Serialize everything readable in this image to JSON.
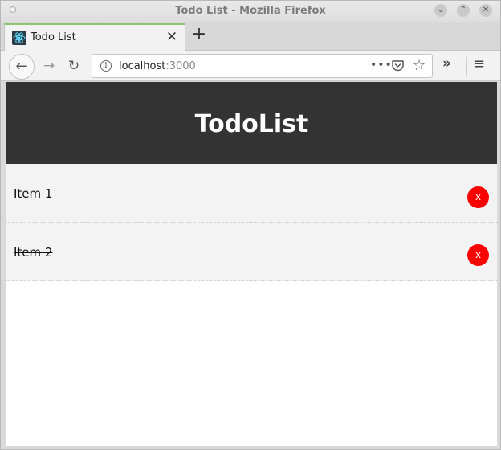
{
  "window": {
    "title": "Todo List - Mozilla Firefox",
    "min_icon": "⌄",
    "max_icon": "⌃",
    "close_icon": "✕"
  },
  "tab": {
    "title": "Todo List",
    "close_icon": "✕"
  },
  "newtab": {
    "icon": "+"
  },
  "nav": {
    "back_icon": "←",
    "forward_icon": "→",
    "reload_icon": "↻",
    "url_host": "localhost",
    "url_port": ":3000",
    "page_actions_icon": "•••",
    "bookmark_icon": "☆",
    "overflow_icon": "»",
    "menu_icon": "≡",
    "info_icon": "i"
  },
  "app": {
    "title": "TodoList",
    "items": [
      {
        "text": "Item 1",
        "done": false,
        "delete_label": "x"
      },
      {
        "text": "Item 2",
        "done": true,
        "delete_label": "x"
      }
    ],
    "delete_color": "#ff0000",
    "header_color": "#333333"
  }
}
